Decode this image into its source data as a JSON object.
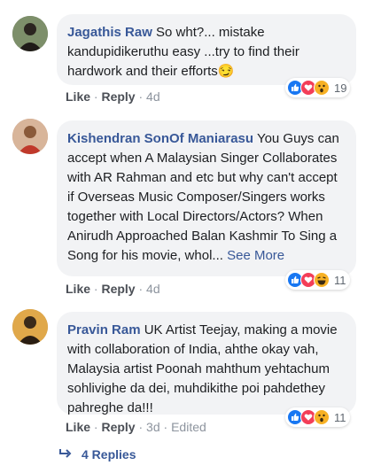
{
  "comments": [
    {
      "author": "Jagathis Raw",
      "text": " So wht?... mistake kandupidikeruthu easy ...try to find their hardwork and their efforts",
      "emoji": "😏",
      "see_more": "",
      "like": "Like",
      "reply": "Reply",
      "time": "4d",
      "edited": "",
      "reaction_count": "19",
      "reaction_icons": [
        "like-icon",
        "love-icon",
        "wow-icon"
      ],
      "avatar_color": "#5b6b4a"
    },
    {
      "author": "Kishendran SonOf Maniarasu",
      "text": " You Guys can accept when A Malaysian Singer Collaborates with AR Rahman and etc but why can't accept if Overseas Music Composer/Singers works together with Local Directors/Actors? When Anirudh Approached Balan Kashmir To Sing a Song for his movie, whol...",
      "emoji": "",
      "see_more": "See More",
      "like": "Like",
      "reply": "Reply",
      "time": "4d",
      "edited": "",
      "reaction_count": "11",
      "reaction_icons": [
        "like-icon",
        "love-icon",
        "haha-icon"
      ],
      "avatar_color": "#c07b5a"
    },
    {
      "author": "Pravin Ram",
      "text": " UK Artist Teejay, making a movie with collaboration of India, ahthe okay vah, Malaysia artist Poonah mahthum yehtachum sohlivighe da dei, muhdikithe poi pahdethey pahreghe da!!!",
      "emoji": "",
      "see_more": "",
      "like": "Like",
      "reply": "Reply",
      "time": "3d",
      "edited": "Edited",
      "reaction_count": "11",
      "reaction_icons": [
        "like-icon",
        "love-icon",
        "wow-icon"
      ],
      "avatar_color": "#b98a3e"
    }
  ],
  "replies": {
    "label": "4 Replies",
    "icon": "reply-arrow-icon"
  },
  "colors": {
    "link": "#385898",
    "bubble": "#f2f3f5",
    "like": "#1877f2",
    "love": "#f33e58",
    "reaction_yellow": "#f7b125"
  }
}
